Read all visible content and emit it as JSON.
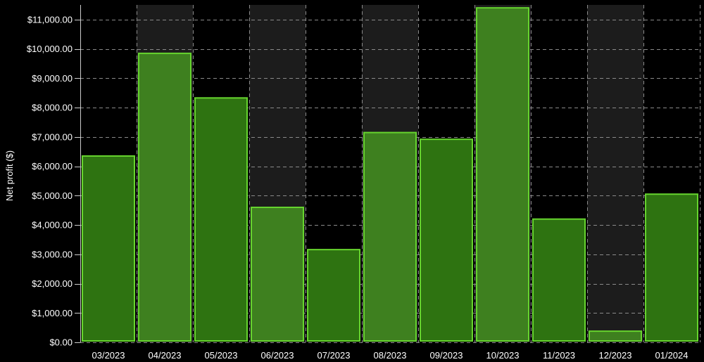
{
  "chart_data": {
    "type": "bar",
    "title": "",
    "xlabel": "",
    "ylabel": "Net profit ($)",
    "categories": [
      "03/2023",
      "04/2023",
      "05/2023",
      "06/2023",
      "07/2023",
      "08/2023",
      "09/2023",
      "10/2023",
      "11/2023",
      "12/2023",
      "01/2024"
    ],
    "values": [
      6350,
      9850,
      8330,
      4600,
      3160,
      7150,
      6920,
      11400,
      4200,
      380,
      5050
    ],
    "ylim": [
      0,
      11500
    ],
    "yticks": [
      0,
      1000,
      2000,
      3000,
      4000,
      5000,
      6000,
      7000,
      8000,
      9000,
      10000,
      11000
    ],
    "ytick_labels": [
      "$0.00",
      "$1,000.00",
      "$2,000.00",
      "$3,000.00",
      "$4,000.00",
      "$5,000.00",
      "$6,000.00",
      "$7,000.00",
      "$8,000.00",
      "$9,000.00",
      "$10,000.00",
      "$11,000.00"
    ],
    "grid": true,
    "legend": "none",
    "colors": {
      "background": "#000000",
      "alternate_band": "#1c1c1c",
      "bar_fill_a": "#2e7311",
      "bar_fill_b": "#3e801f",
      "bar_stroke": "#66d42e",
      "text": "#ffffff",
      "grid": "#8a8a8a"
    }
  }
}
